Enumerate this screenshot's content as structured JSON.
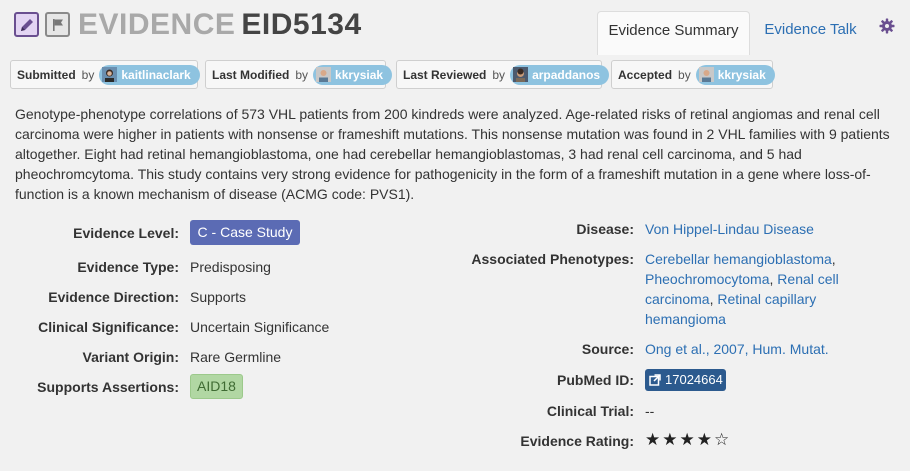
{
  "header": {
    "title_prefix": "EVIDENCE",
    "title_id": "EID5134",
    "tabs": [
      {
        "label": "Evidence Summary"
      },
      {
        "label": "Evidence Talk"
      }
    ]
  },
  "attributions": [
    {
      "label": "Submitted",
      "by": "by",
      "user": "kaitlinaclark"
    },
    {
      "label": "Last Modified",
      "by": "by",
      "user": "kkrysiak"
    },
    {
      "label": "Last Reviewed",
      "by": "by",
      "user": "arpaddanos"
    },
    {
      "label": "Accepted",
      "by": "by",
      "user": "kkrysiak"
    }
  ],
  "description": "Genotype-phenotype correlations of 573 VHL patients from 200 kindreds were analyzed. Age-related risks of retinal angiomas and renal cell carcinoma were higher in patients with nonsense or frameshift mutations. This nonsense mutation was found in 2 VHL families with 9 patients altogether. Eight had retinal hemangioblastoma, one had cerebellar hemangioblastomas, 3 had renal cell carcinoma, and 5 had pheochromcytoma. This study contains very strong evidence for pathogenicity in the form of a frameshift mutation in a gene where loss-of-function is a known mechanism of disease (ACMG code: PVS1).",
  "left_fields": {
    "evidence_level": {
      "label": "Evidence Level:",
      "value": "C - Case Study"
    },
    "evidence_type": {
      "label": "Evidence Type:",
      "value": "Predisposing"
    },
    "evidence_direction": {
      "label": "Evidence Direction:",
      "value": "Supports"
    },
    "clinical_significance": {
      "label": "Clinical Significance:",
      "value": "Uncertain Significance"
    },
    "variant_origin": {
      "label": "Variant Origin:",
      "value": "Rare Germline"
    },
    "supports_assertions": {
      "label": "Supports Assertions:",
      "value": "AID18"
    }
  },
  "right_fields": {
    "disease": {
      "label": "Disease:",
      "value": "Von Hippel-Lindau Disease"
    },
    "phenotypes": {
      "label": "Associated Phenotypes:",
      "items": [
        "Cerebellar hemangioblastoma",
        "Pheochromocytoma",
        "Renal cell carcinoma",
        "Retinal capillary hemangioma"
      ],
      "separator": ","
    },
    "source": {
      "label": "Source:",
      "value": "Ong et al., 2007, Hum. Mutat."
    },
    "pubmed": {
      "label": "PubMed ID:",
      "value": "17024664"
    },
    "clinical_trial": {
      "label": "Clinical Trial:",
      "value": "--"
    },
    "rating": {
      "label": "Evidence Rating:",
      "value": 4,
      "max": 5,
      "stars_text": "★★★★☆"
    }
  },
  "colors": {
    "level_badge": "#5b6bb4",
    "assertion_badge": "#b1d7a3",
    "user_pill": "#8ec3e0",
    "link": "#2c6fb3",
    "pubmed_badge": "#2c5a8e"
  },
  "icons": [
    "pencil-icon",
    "flag-icon",
    "gear-icon",
    "external-link-icon",
    "user-avatar"
  ]
}
